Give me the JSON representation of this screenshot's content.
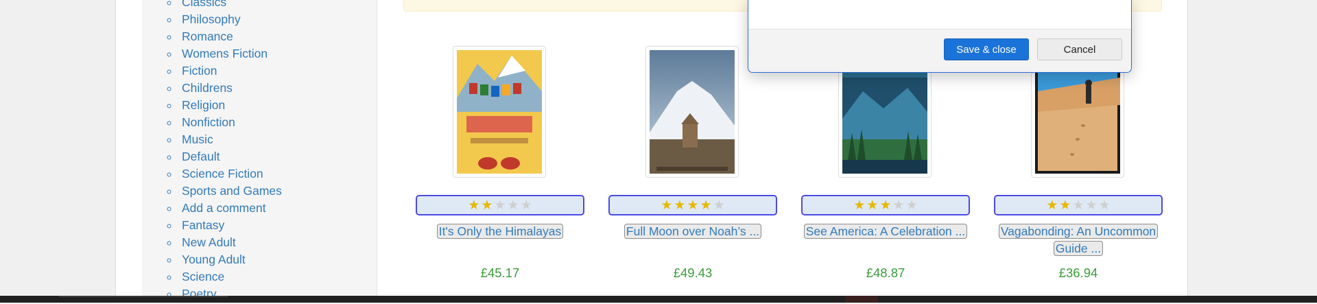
{
  "sidebar": {
    "categories": [
      "Classics",
      "Philosophy",
      "Romance",
      "Womens Fiction",
      "Fiction",
      "Childrens",
      "Religion",
      "Nonfiction",
      "Music",
      "Default",
      "Science Fiction",
      "Sports and Games",
      "Add a comment",
      "Fantasy",
      "New Adult",
      "Young Adult",
      "Science",
      "Poetry"
    ]
  },
  "products": [
    {
      "title": "It's Only the Himalayas",
      "price": "£45.17",
      "rating": 2,
      "cover_colors": [
        "#f2c94c",
        "#7aa7c7"
      ]
    },
    {
      "title": "Full Moon over Noah’s ...",
      "price": "£49.43",
      "rating": 4,
      "cover_colors": [
        "#8fa7bf",
        "#6d5a45"
      ]
    },
    {
      "title": "See America: A Celebration ...",
      "price": "£48.87",
      "rating": 3,
      "cover_colors": [
        "#1f5a7a",
        "#2f6f3f"
      ]
    },
    {
      "title": "Vagabonding: An Uncommon Guide ...",
      "price": "£36.94",
      "rating": 2,
      "cover_colors": [
        "#3a9ad9",
        "#e0b07a"
      ]
    }
  ],
  "dialog": {
    "save_label": "Save & close",
    "cancel_label": "Cancel"
  },
  "colors": {
    "link": "#337ab7",
    "price": "#3c9c3c",
    "star": "#e6b800",
    "primary_button": "#1a73d9"
  }
}
